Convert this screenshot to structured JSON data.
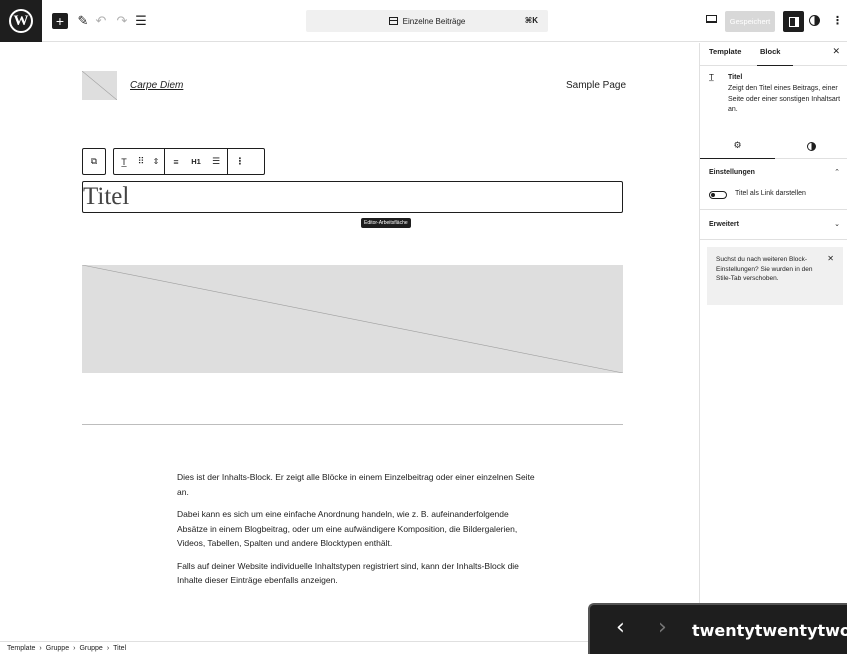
{
  "toolbar": {
    "logo_letter": "W",
    "add_icon": "plus-icon",
    "pen_icon": "pencil-icon",
    "undo_icon": "undo-icon",
    "redo_icon": "redo-icon",
    "list_icon": "document-overview-icon",
    "command_label": "Einzelne Beiträge",
    "command_shortcut": "⌘K",
    "save_label": "Gespeichert"
  },
  "canvas": {
    "site_title": "Carpe Diem",
    "nav_link": "Sample Page",
    "heading_level": "H1",
    "post_title": "Titel",
    "tooltip": "Editor-Arbeitsfläche",
    "content": [
      "Dies ist der Inhalts-Block. Er zeigt alle Blöcke in einem Einzelbeitrag oder einer einzelnen Seite an.",
      "Dabei kann es sich um eine einfache Anordnung handeln, wie z. B. aufeinanderfolgende Absätze in einem Blogbeitrag, oder um eine aufwändigere Komposition, die Bildergalerien, Videos, Tabellen, Spalten und andere Blocktypen enthält.",
      "Falls auf deiner Website individuelle Inhaltstypen registriert sind, kann der Inhalts-Block die Inhalte dieser Einträge ebenfalls anzeigen."
    ]
  },
  "breadcrumb": [
    "Template",
    "Gruppe",
    "Gruppe",
    "Titel"
  ],
  "sidebar": {
    "tab_template": "Template",
    "tab_block": "Block",
    "block_name": "Titel",
    "block_desc": "Zeigt den Titel eines Beitrags, einer Seite oder einer sonstigen Inhaltsart an.",
    "settings_title": "Einstellungen",
    "toggle_label": "Titel als Link darstellen",
    "advanced_title": "Erweitert",
    "notice": "Suchst du nach weiteren Block-Einstellungen? Sie wurden in den Stile-Tab verschoben."
  },
  "overlay": {
    "prev": "‹",
    "next": "›",
    "title": "twentytwentytwo"
  }
}
